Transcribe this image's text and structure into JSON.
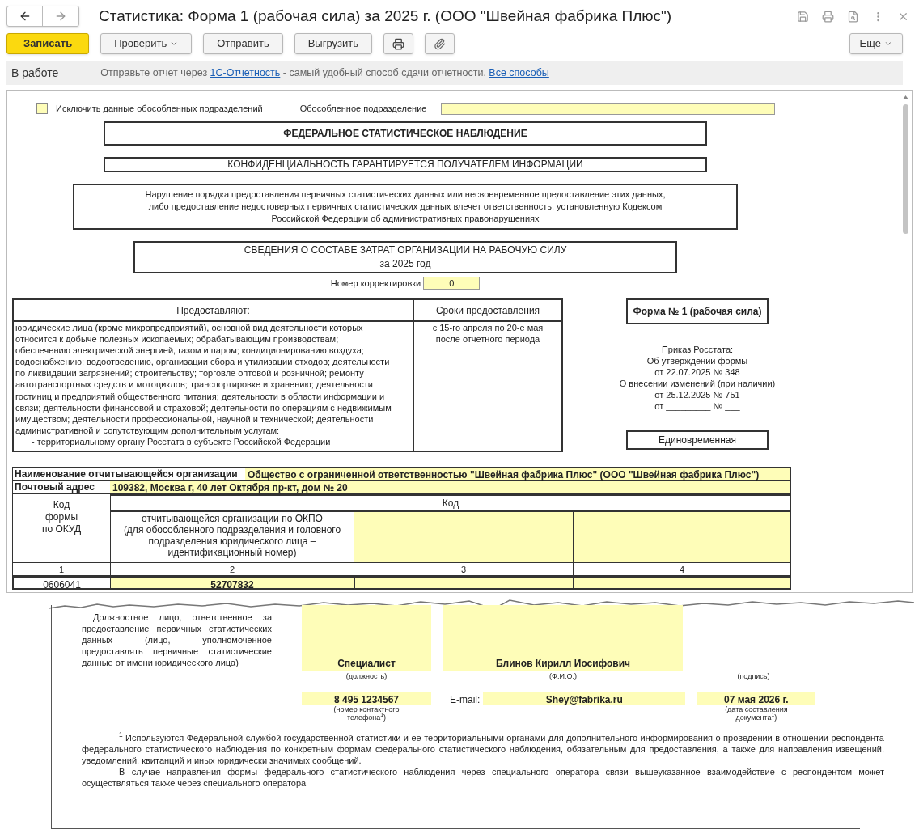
{
  "window": {
    "title": "Статистика: Форма 1 (рабочая сила) за 2025 г. (ООО \"Швейная фабрика Плюс\")"
  },
  "toolbar": {
    "buttons": [
      {
        "kind": "primary",
        "label": "Записать"
      },
      {
        "kind": "dropdown",
        "label": "Проверить"
      },
      {
        "kind": "plain",
        "label": "Отправить"
      },
      {
        "kind": "plain",
        "label": "Выгрузить"
      },
      {
        "kind": "print"
      },
      {
        "kind": "attach"
      }
    ],
    "more": "Еще"
  },
  "status_bar": {
    "status": "В работе",
    "before": "Отправьте отчет через ",
    "link": "1С-Отчетность",
    "after": " - самый удобный способ сдачи отчетности.",
    "link2": "Все способы"
  },
  "form": {
    "exclude": {
      "label": "Исключить данные обособленных подразделений",
      "checked": false
    },
    "subdivision_label": "Обособленное подразделение",
    "survey_title": "ФЕДЕРАЛЬНОЕ СТАТИСТИЧЕСКОЕ НАБЛЮДЕНИЕ",
    "confidentiality": "КОНФИДЕНЦИАЛЬНОСТЬ ГАРАНТИРУЕТСЯ ПОЛУЧАТЕЛЕМ ИНФОРМАЦИИ",
    "notice_lines": [
      "Нарушение порядка предоставления первичных статистических данных или несвоевременное предоставление этих данных,",
      "либо предоставление недостоверных первичных статистических данных влечет ответственность, установленную Кодексом",
      "Российской Федерации об административных правонарушениях"
    ],
    "report_title": [
      "СВЕДЕНИЯ О СОСТАВЕ ЗАТРАТ ОРГАНИЗАЦИИ НА РАБОЧУЮ СИЛУ",
      "за 2025 год"
    ],
    "correction": {
      "label": "Номер корректировки",
      "value": "0"
    },
    "providers": {
      "headers": [
        "Предоставляют:",
        "Сроки предоставления"
      ],
      "lines": [
        "юридические лица (кроме микропредприятий), основной вид деятельности которых",
        "относится к добыче полезных ископаемых; обрабатывающим производствам;",
        "обеспечению электрической энергией, газом и паром; кондиционированию воздуха;",
        "водоснабжению; водоотведению, организации сбора и утилизации отходов; деятельности",
        "по ликвидации загрязнений; строительству; торговле оптовой и розничной; ремонту",
        "автотранспортных средств и мотоциклов; транспортировке и хранению; деятельности",
        "гостиниц и предприятий общественного питания; деятельности в области информации и",
        "связи; деятельности финансовой и страховой; деятельности по операциям с недвижимым",
        "имуществом; деятельности профессиональной, научной и технической; деятельности",
        "административной и сопутствующим дополнительным услугам:"
      ],
      "recipient": "- территориальному органу Росстата в субъекте Российской Федерации",
      "deadline_lines": [
        "с 15-го апреля по 20-е мая",
        "после отчетного периода"
      ]
    },
    "form_name": "Форма № 1 (рабочая сила)",
    "order_lines": [
      "Приказ Росстата:",
      "Об утверждении формы",
      "от 22.07.2025 № 348",
      "О внесении изменений (при наличии)",
      "от 25.12.2025 № 751",
      "от _________ № ___"
    ],
    "periodicity": "Единовременная",
    "org": {
      "label": "Наименование отчитывающейся организации",
      "value": "Общество с ограниченной ответственностью \"Швейная фабрика Плюс\" (ООО \"Швейная фабрика Плюс\")"
    },
    "address": {
      "label": "Почтовый адрес",
      "value": "109382, Москва г, 40 лет Октября пр-кт, дом № 20"
    },
    "codes": {
      "okud_header": [
        "Код",
        "формы",
        "по ОКУД"
      ],
      "code_header": "Код",
      "okpo_header": [
        "отчитывающейся организации по ОКПО",
        "(для обособленного подразделения и головного",
        "подразделения юридического лица –",
        "идентификационный номер)"
      ],
      "numbers": [
        "1",
        "2",
        "3",
        "4"
      ],
      "okud": "0606041",
      "okpo": "52707832"
    }
  },
  "signature": {
    "text": "Должностное лицо, ответственное за предоставление первичных статистических данных (лицо, уполномоченное предоставлять первичные статистические данные от имени юридического лица)",
    "position": "Специалист",
    "position_caption": "(должность)",
    "name": "Блинов Кирилл Иосифович",
    "name_caption": "(Ф.И.О.)",
    "sign_caption": "(подпись)",
    "phone": "8 495 1234567",
    "phone_caption": "(номер контактного телефона$^{1}$)",
    "email_label": "E-mail:",
    "email": "Shey@fabrika.ru",
    "date": "07 мая 2026 г.",
    "date_caption": "(дата составления документа$^{1}$)"
  },
  "footnotes": [
    "$^{1}$ Используются Федеральной службой государственной статистики и ее территориальными органами для дополнительного информирования о проведении в отношении респондента федерального статистического наблюдения по конкретным формам федерального статистического наблюдения, обязательным для предоставления, а также для направления извещений, уведомлений, квитанций и иных юридически значимых сообщений.",
    "В случае направления формы федерального статистического наблюдения через специального оператора связи вышеуказанное взаимодействие с респондентом может осуществляться также через специального оператора"
  ]
}
